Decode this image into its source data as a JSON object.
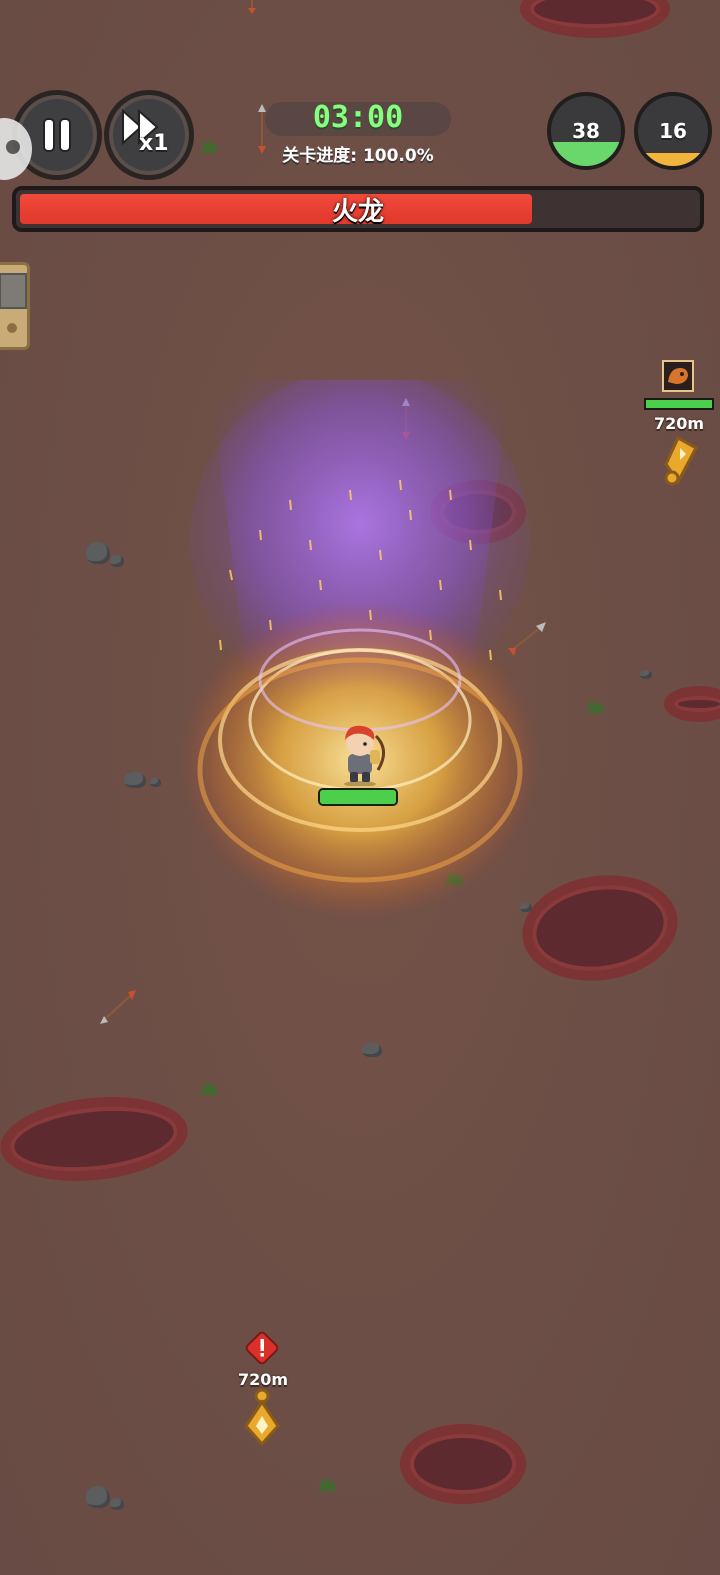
{
  "controls": {
    "speed_label": "x1"
  },
  "timer": {
    "value": "03:00"
  },
  "level_progress": {
    "text": "关卡进度: 100.0%"
  },
  "stats": [
    {
      "value": "38",
      "fill_fraction": 0.35,
      "fill_color": "#69d76b"
    },
    {
      "value": "16",
      "fill_fraction": 0.18,
      "fill_color": "#f0b53a"
    }
  ],
  "boss": {
    "name": "火龙",
    "hp_fraction": 0.76,
    "bar_color": "#e2382d"
  },
  "offscreen_markers": [
    {
      "label": "720m",
      "type": "boss"
    },
    {
      "label": "720m",
      "type": "warning"
    }
  ],
  "player": {
    "hp_fraction": 1.0
  },
  "colors": {
    "ground": "#6e5048",
    "timer_text": "#84ff7e",
    "hp_green": "#4ccf4a"
  },
  "icons": [
    "pause-icon",
    "fast-forward-icon",
    "boss-dragon-icon",
    "warning-icon",
    "direction-pointer-icon",
    "side-device-icon"
  ]
}
